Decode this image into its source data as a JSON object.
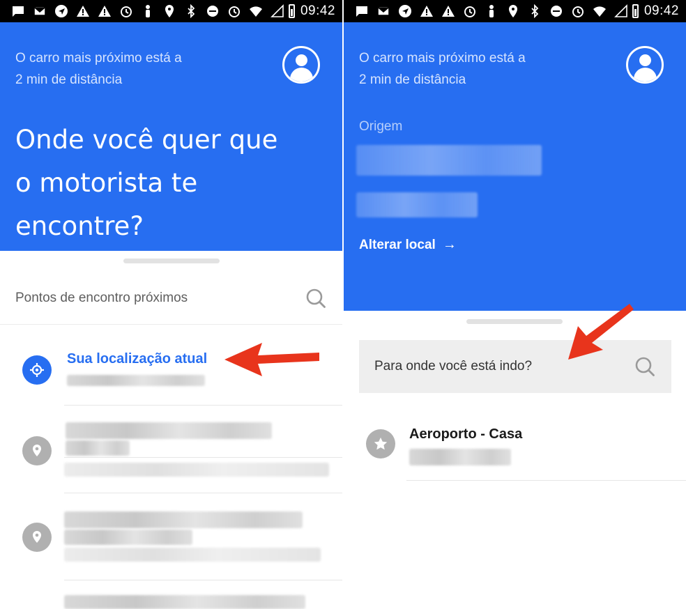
{
  "status_bar": {
    "time": "09:42",
    "icons": [
      "chat-icon",
      "mail-icon",
      "send-icon",
      "warning-icon",
      "warning-icon",
      "alarm-icon",
      "figure-icon",
      "location-icon",
      "bluetooth-icon",
      "do-not-disturb-icon",
      "alarm-icon",
      "wifi-icon",
      "signal-icon",
      "battery-icon"
    ]
  },
  "colors": {
    "uber_blue": "#276ef1",
    "arrow_red": "#e8341c",
    "muted_gray": "#b0b0b0"
  },
  "left_screen": {
    "nearest_car_line1": "O carro mais próximo está a",
    "nearest_car_line2": "2 min de distância",
    "question": "Onde você quer que o motorista te encontre?",
    "section_title": "Pontos de encontro próximos",
    "current_location_label": "Sua localização atual"
  },
  "right_screen": {
    "nearest_car_line1": "O carro mais próximo está a",
    "nearest_car_line2": "2 min de distância",
    "origin_label": "Origem",
    "change_location_label": "Alterar local",
    "destination_placeholder": "Para onde você está indo?",
    "saved_place_title": "Aeroporto - Casa"
  }
}
